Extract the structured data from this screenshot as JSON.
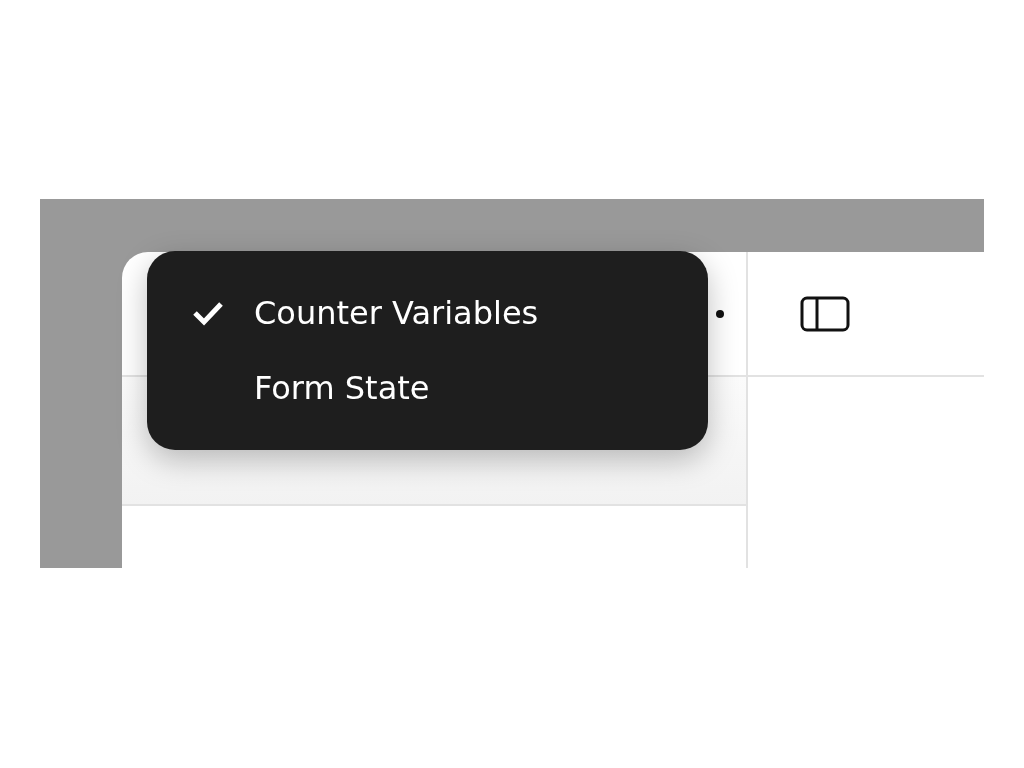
{
  "menu": {
    "items": [
      {
        "label": "Counter Variables",
        "selected": true
      },
      {
        "label": "Form State",
        "selected": false
      }
    ]
  }
}
